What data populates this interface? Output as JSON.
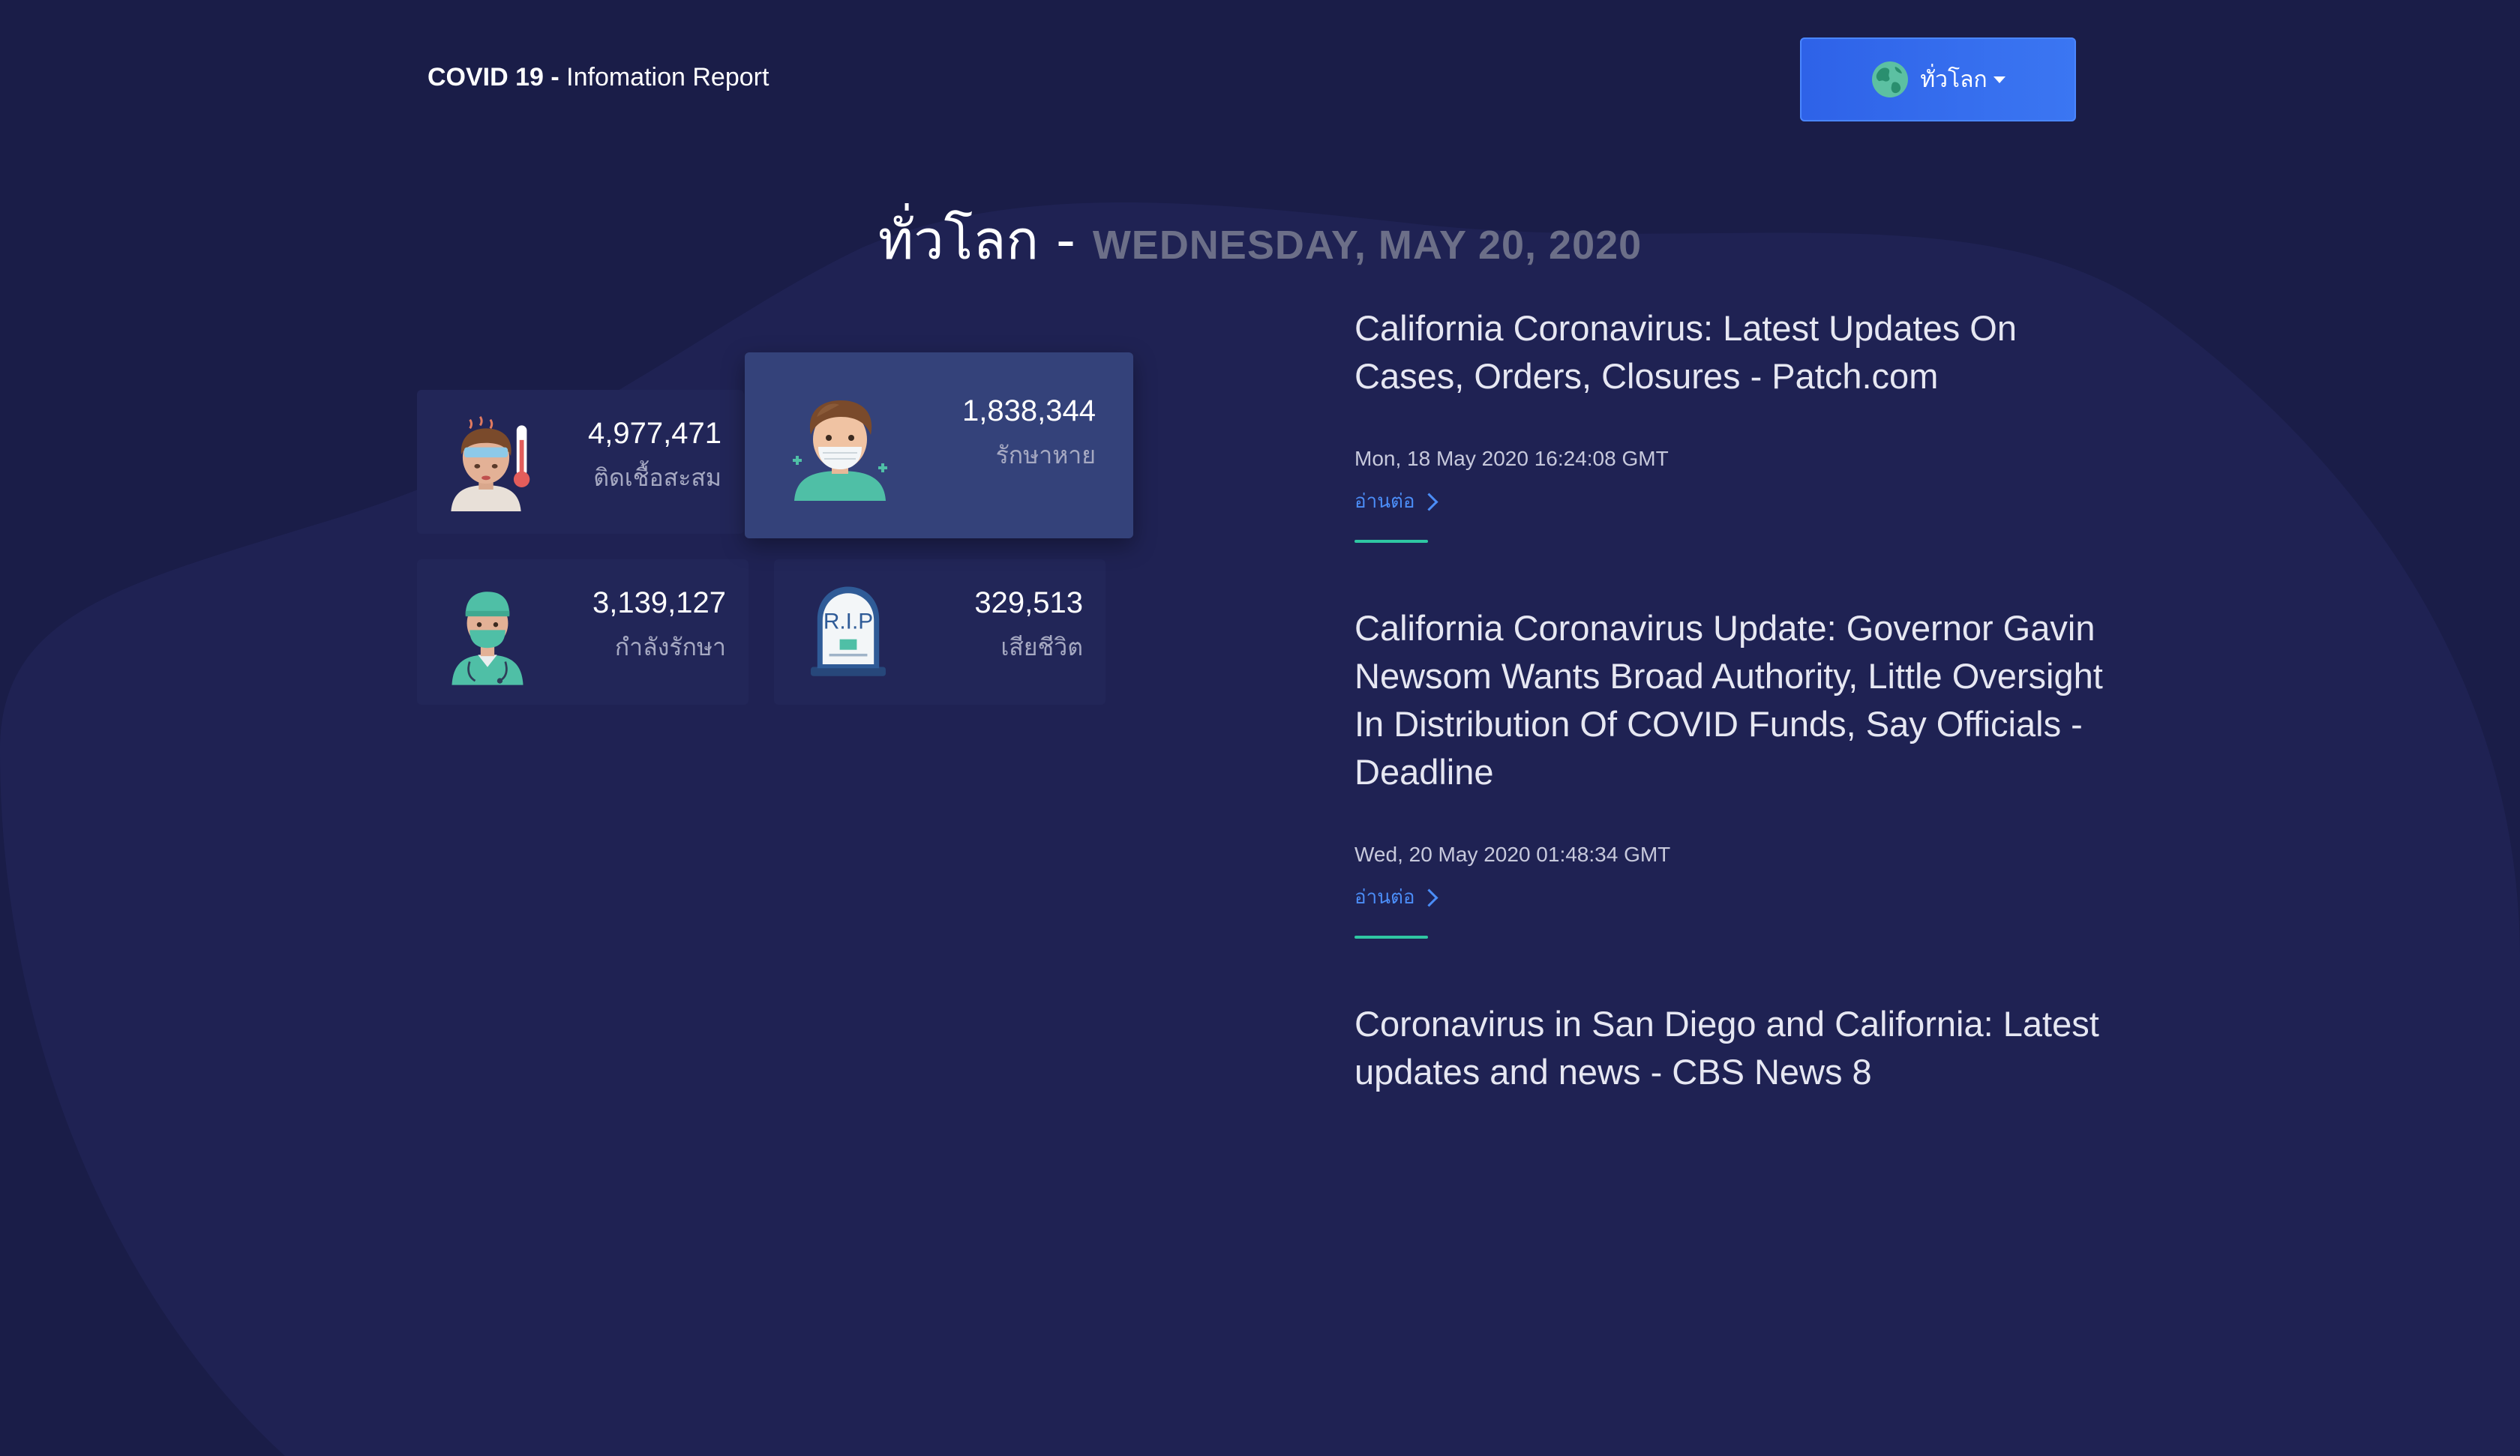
{
  "brand": {
    "bold": "COVID 19 -",
    "rest": " Infomation Report"
  },
  "region_selector": {
    "label": "ทั่วโลก",
    "icon": "globe-icon"
  },
  "title": {
    "region": "ทั่วโลก - ",
    "date": "WEDNESDAY, MAY 20, 2020"
  },
  "stats": {
    "confirmed": {
      "value": "4,977,471",
      "label": "ติดเชื้อสะสม",
      "icon": "sick-person-thermometer-icon"
    },
    "recovered": {
      "value": "1,838,344",
      "label": "รักษาหาย",
      "icon": "masked-person-icon"
    },
    "treating": {
      "value": "3,139,127",
      "label": "กำลังรักษา",
      "icon": "doctor-icon"
    },
    "deaths": {
      "value": "329,513",
      "label": "เสียชีวิต",
      "icon": "tombstone-rip-icon",
      "tombstone_text": "R.I.P"
    }
  },
  "news": [
    {
      "title": "California Coronavirus: Latest Updates On Cases, Orders, Closures - Patch.com",
      "date": "Mon, 18 May 2020 16:24:08 GMT",
      "more": "อ่านต่อ"
    },
    {
      "title": "California Coronavirus Update: Governor Gavin Newsom Wants Broad Authority, Little Oversight In Distribution Of COVID Funds, Say Officials - Deadline",
      "date": "Wed, 20 May 2020 01:48:34 GMT",
      "more": "อ่านต่อ"
    },
    {
      "title": "Coronavirus in San Diego and California: Latest updates and news - CBS News 8"
    }
  ],
  "colors": {
    "background": "#1a1d48",
    "card": "#222658",
    "card_highlight": "#34427a",
    "accent_button": "#3b76f2",
    "link": "#4b8df7",
    "rule": "#2fc7a3"
  }
}
